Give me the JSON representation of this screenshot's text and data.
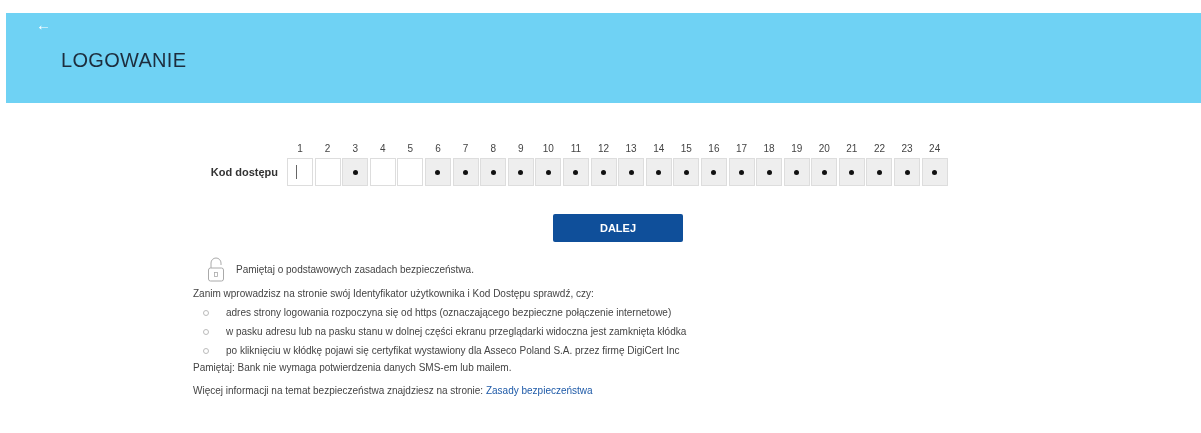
{
  "header": {
    "back_icon": "←",
    "title": "LOGOWANIE"
  },
  "access_code": {
    "label": "Kod dostępu",
    "cells": [
      {
        "number": "1",
        "kind": "cursor"
      },
      {
        "number": "2",
        "kind": "empty"
      },
      {
        "number": "3",
        "kind": "masked"
      },
      {
        "number": "4",
        "kind": "empty"
      },
      {
        "number": "5",
        "kind": "empty"
      },
      {
        "number": "6",
        "kind": "masked"
      },
      {
        "number": "7",
        "kind": "masked"
      },
      {
        "number": "8",
        "kind": "masked"
      },
      {
        "number": "9",
        "kind": "masked"
      },
      {
        "number": "10",
        "kind": "masked"
      },
      {
        "number": "11",
        "kind": "masked"
      },
      {
        "number": "12",
        "kind": "masked"
      },
      {
        "number": "13",
        "kind": "masked"
      },
      {
        "number": "14",
        "kind": "masked"
      },
      {
        "number": "15",
        "kind": "masked"
      },
      {
        "number": "16",
        "kind": "masked"
      },
      {
        "number": "17",
        "kind": "masked"
      },
      {
        "number": "18",
        "kind": "masked"
      },
      {
        "number": "19",
        "kind": "masked"
      },
      {
        "number": "20",
        "kind": "masked"
      },
      {
        "number": "21",
        "kind": "masked"
      },
      {
        "number": "22",
        "kind": "masked"
      },
      {
        "number": "23",
        "kind": "masked"
      },
      {
        "number": "24",
        "kind": "masked"
      }
    ]
  },
  "submit_button": "DALEJ",
  "security": {
    "heading": "Pamiętaj o podstawowych zasadach bezpieczeństwa.",
    "intro": "Zanim wprowadzisz na stronie swój Identyfikator użytkownika i Kod Dostępu sprawdź, czy:",
    "checks": [
      "adres strony logowania rozpoczyna się od https (oznaczającego bezpieczne połączenie internetowe)",
      "w pasku adresu lub na pasku stanu w dolnej części ekranu przeglądarki widoczna jest zamknięta kłódka",
      "po kliknięciu w kłódkę pojawi się certyfikat wystawiony dla Asseco Poland S.A. przez firmę DigiCert Inc"
    ],
    "reminder": "Pamiętaj: Bank nie wymaga potwierdzenia danych SMS-em lub mailem.",
    "more_info": "Więcej informacji na temat bezpieczeństwa znajdziesz na stronie:",
    "more_info_link": "Zasady bezpieczeństwa"
  }
}
